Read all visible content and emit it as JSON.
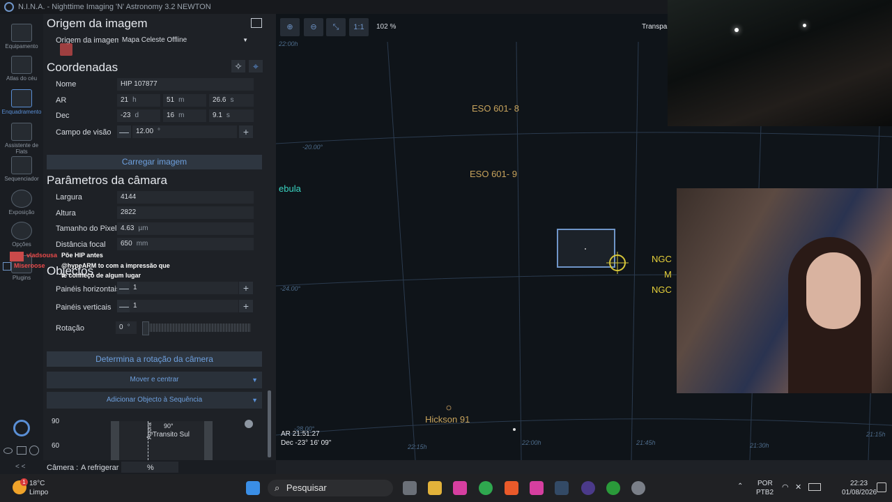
{
  "app": {
    "title": "N.I.N.A. - Nighttime Imaging 'N' Astronomy 3.2",
    "profile": "NEWTON"
  },
  "nav": {
    "items": [
      {
        "label": "Equipamento",
        "icon": "telescope-icon"
      },
      {
        "label": "Atlas do céu",
        "icon": "sky-atlas-icon"
      },
      {
        "label": "Enquadramento",
        "icon": "framing-icon"
      },
      {
        "label": "Assistente de Flats",
        "icon": "flats-icon"
      },
      {
        "label": "Sequenciador",
        "icon": "sequencer-icon"
      },
      {
        "label": "Exposição",
        "icon": "exposure-icon"
      },
      {
        "label": "Opções",
        "icon": "gear-icon"
      },
      {
        "label": "Plugins",
        "icon": "plugins-icon"
      }
    ],
    "collapse": "< <"
  },
  "image_source": {
    "heading": "Origem da imagem",
    "label": "Origem da imagem",
    "value": "Mapa Celeste Offline"
  },
  "coordinates": {
    "heading": "Coordenadas",
    "name_label": "Nome",
    "name_value": "HIP 107877",
    "ra_label": "AR",
    "ra_h": "21",
    "ra_h_unit": "h",
    "ra_m": "51",
    "ra_m_unit": "m",
    "ra_s": "26.6",
    "ra_s_unit": "s",
    "dec_label": "Dec",
    "dec_d": "-23",
    "dec_d_unit": "d",
    "dec_m": "16",
    "dec_m_unit": "m",
    "dec_s": "9.1",
    "dec_s_unit": "s",
    "fov_label": "Campo de visão",
    "fov_value": "12.00",
    "fov_unit": "°"
  },
  "load_button": "Carregar imagem",
  "camera": {
    "heading": "Parâmetros da câmara",
    "width_label": "Largura",
    "width_value": "4144",
    "height_label": "Altura",
    "height_value": "2822",
    "pixel_label": "Tamanho do Pixel",
    "pixel_value": "4.63",
    "pixel_unit": "µm",
    "focal_label": "Distância focal",
    "focal_value": "650",
    "focal_unit": "mm"
  },
  "mosaic": {
    "heading": "Objectos",
    "hpanels_label": "Painéis horizontais",
    "hpanels_value": "1",
    "vpanels_label": "Painéis verticais",
    "vpanels_value": "1",
    "rotation_label": "Rotação",
    "rotation_value": "0",
    "rotation_unit": "°"
  },
  "buttons": {
    "rotation": "Determina a rotação da câmera",
    "slew": "Mover e centrar",
    "add_sequence": "Adicionar Objecto à Sequência"
  },
  "altitude": {
    "y90": "90",
    "y60": "60",
    "now": "Agora",
    "transit_deg": "90°",
    "transit": "Transito Sul"
  },
  "status": {
    "label": "Câmera :",
    "value": "A refrigerar",
    "percent": "%"
  },
  "chat": {
    "user1": "vladsousa",
    "msg1": "Põe HIP antes",
    "user2": "Miseroose",
    "msg2a": "@hypeARM to com a impressão que",
    "msg2b": "te conheço de algum lugar"
  },
  "sky": {
    "zoom": "102 %",
    "one_to_one": "1:1",
    "transparency": "Transpar",
    "labels": {
      "eso8": "ESO 601- 8",
      "eso9": "ESO 601- 9",
      "hickson": "Hickson 91",
      "nebula": "ebula",
      "ngc1": "NGC",
      "m": "M",
      "ngc2": "NGC"
    },
    "grid": {
      "dec20": "-20.00°",
      "dec24": "-24.00°",
      "dec28": "-28.00°",
      "ra2215": "22:15h",
      "ra2200": "22:00h",
      "ra2145": "21:45h",
      "ra2130": "21:30h",
      "ra2115": "21:15h",
      "top": "22:00h"
    },
    "readout_ra": "AR 21:51:27",
    "readout_dec": "Dec -23° 16' 09\""
  },
  "taskbar": {
    "weather_temp": "18°C",
    "weather_desc": "Limpo",
    "badge": "1",
    "search": "Pesquisar",
    "lang1": "POR",
    "lang2": "PTB2",
    "time": "22:23",
    "date": "01/08/2026"
  }
}
